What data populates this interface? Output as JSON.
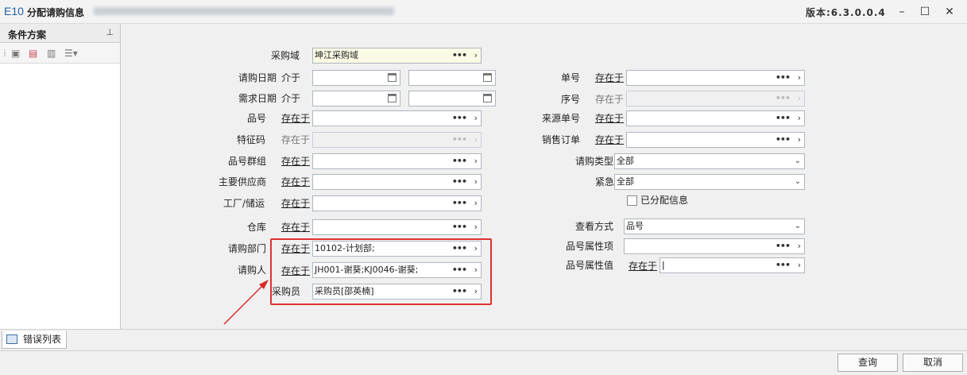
{
  "window": {
    "logo": "E10",
    "title": "分配请购信息",
    "version": "版本:6.3.0.0.4",
    "min_icon": "minimize-icon",
    "max_icon": "maximize-icon",
    "close_icon": "close-icon"
  },
  "left_panel": {
    "title": "条件方案",
    "pin": "ᵖ",
    "tools": [
      "save-icon",
      "save-as-icon",
      "delete-icon",
      "list-menu-icon"
    ]
  },
  "form": {
    "cond_exist": "存在于",
    "cond_between": "介于",
    "buy_domain": {
      "label": "采购域",
      "value": "坤江采购域"
    },
    "req_date": {
      "label": "请购日期"
    },
    "need_date": {
      "label": "需求日期"
    },
    "item_no": {
      "label": "品号"
    },
    "feature": {
      "label": "特征码"
    },
    "item_group": {
      "label": "品号群组"
    },
    "supplier": {
      "label": "主要供应商"
    },
    "factory": {
      "label": "工厂/储运"
    },
    "warehouse": {
      "label": "仓库"
    },
    "dept": {
      "label": "请购部门",
      "value": "10102-计划部;"
    },
    "requester": {
      "label": "请购人",
      "value": "JH001-谢葵;KJ0046-谢葵;"
    },
    "buyer": {
      "label": "采购员",
      "value": "采购员[邵英楠]"
    },
    "doc_no": {
      "label": "单号"
    },
    "seq_no": {
      "label": "序号"
    },
    "source_no": {
      "label": "来源单号"
    },
    "sales_order": {
      "label": "销售订单"
    },
    "req_type": {
      "label": "请购类型",
      "value": "全部"
    },
    "urgent": {
      "label": "紧急",
      "value": "全部"
    },
    "assigned": {
      "label": "已分配信息"
    },
    "view_mode": {
      "label": "查看方式",
      "value": "品号"
    },
    "item_attr": {
      "label": "品号属性项"
    },
    "item_attr_val": {
      "label": "品号属性值"
    }
  },
  "bottom": {
    "tab": "错误列表",
    "query": "查询",
    "cancel": "取消"
  },
  "colors": {
    "highlight": "#e03030",
    "accent": "#1f5fa8"
  }
}
